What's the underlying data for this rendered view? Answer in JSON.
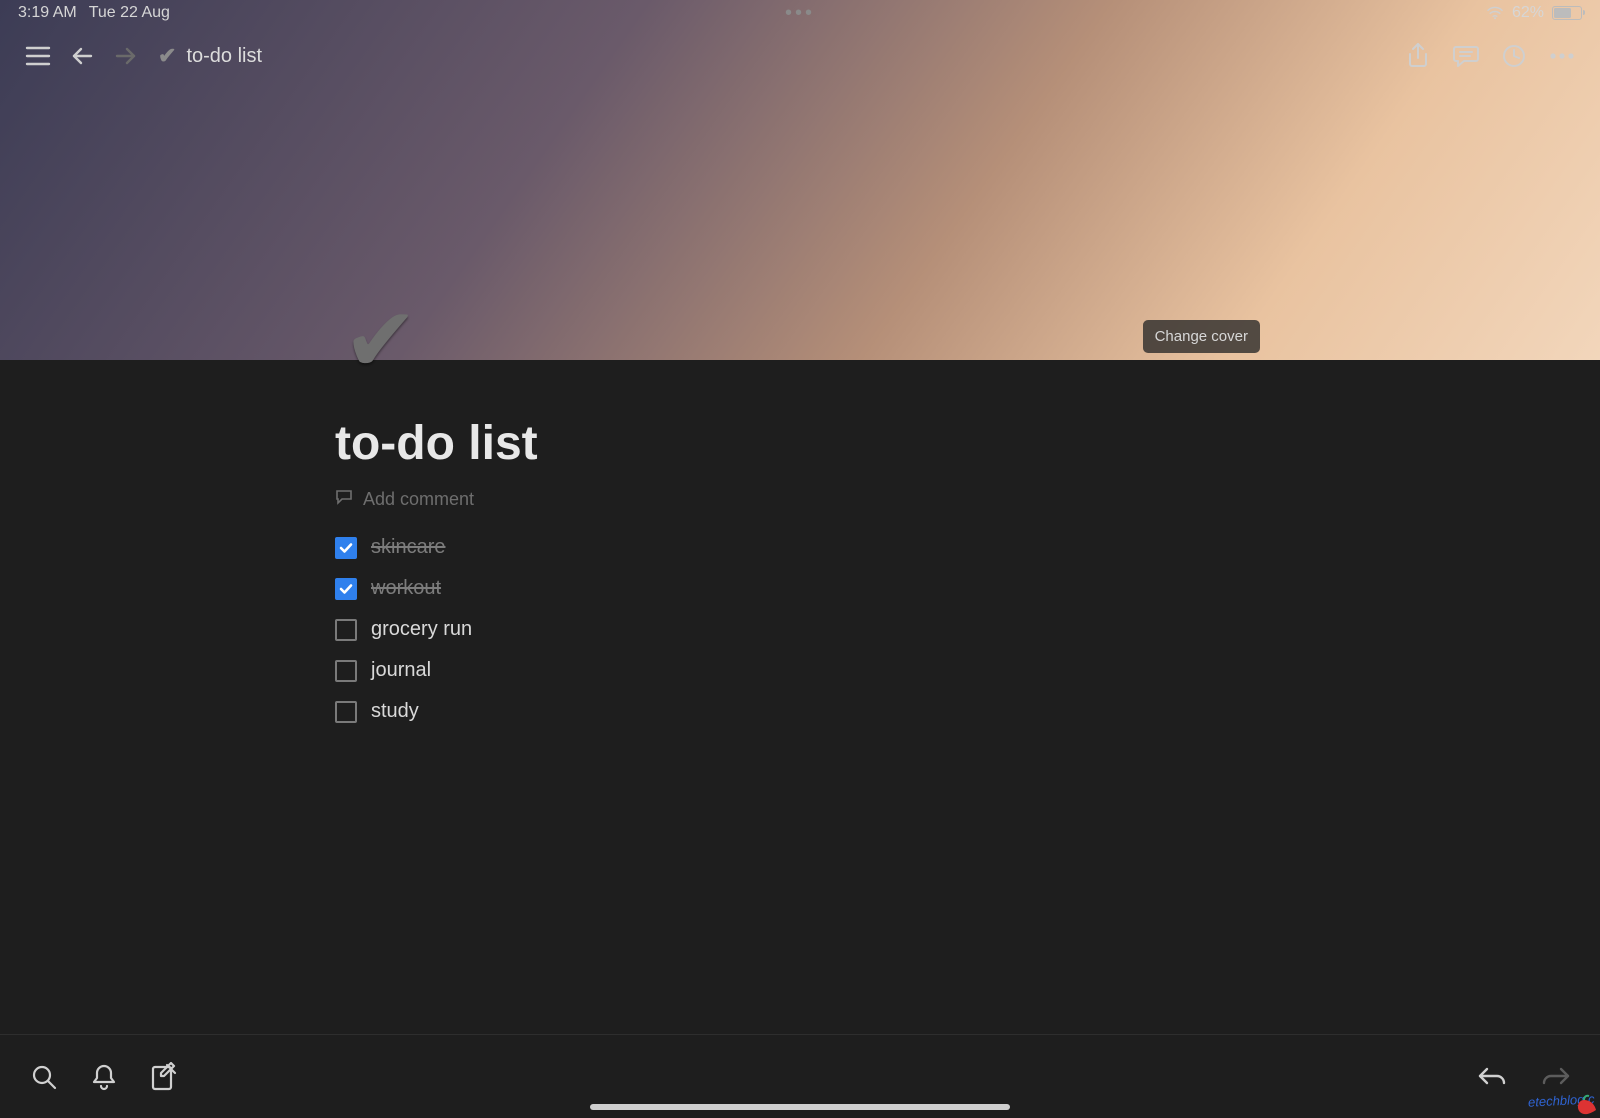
{
  "status": {
    "time": "3:19 AM",
    "date": "Tue 22 Aug",
    "battery_pct": "62%"
  },
  "toolbar": {
    "title": "to-do list"
  },
  "cover": {
    "change_label": "Change cover"
  },
  "page": {
    "title": "to-do list",
    "add_comment": "Add comment"
  },
  "todos": [
    {
      "label": "skincare",
      "checked": true
    },
    {
      "label": "workout",
      "checked": true
    },
    {
      "label": "grocery run",
      "checked": false
    },
    {
      "label": "journal",
      "checked": false
    },
    {
      "label": "study",
      "checked": false
    }
  ],
  "watermark": "etechblog.c"
}
